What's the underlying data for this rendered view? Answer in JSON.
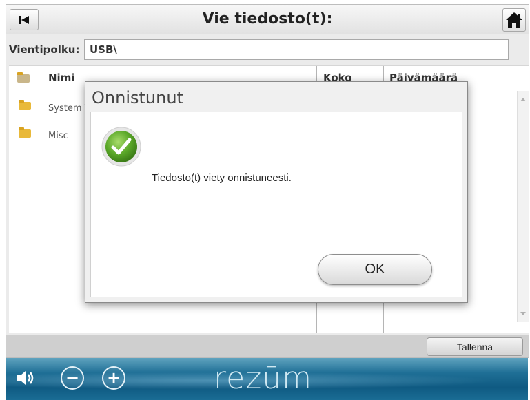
{
  "header": {
    "title": "Vie tiedosto(t):",
    "back_icon": "skip-back-icon",
    "home_icon": "home-icon"
  },
  "export_path": {
    "label": "Vientipolku:",
    "value": "USB\\"
  },
  "file_list": {
    "columns": {
      "name": "Nimi",
      "size": "Koko",
      "date": "Päivämäärä"
    },
    "rows": [
      {
        "name": "System V",
        "icon": "folder-icon"
      },
      {
        "name": "Misc",
        "icon": "folder-icon"
      }
    ]
  },
  "bottom_bar": {
    "save_label": "Tallenna"
  },
  "footer": {
    "volume_icon": "speaker-icon",
    "minus_label": "−",
    "plus_label": "+",
    "brand": "rezūm"
  },
  "dialog": {
    "title": "Onnistunut",
    "message": "Tiedosto(t) viety onnistuneesti.",
    "ok_label": "OK",
    "icon": "success-check-icon"
  },
  "colors": {
    "dialog_background": "#f0f0f0",
    "success_green": "#5aa728",
    "footer_blue": "#1f6f96",
    "folder_yellow": "#e9b93a"
  }
}
